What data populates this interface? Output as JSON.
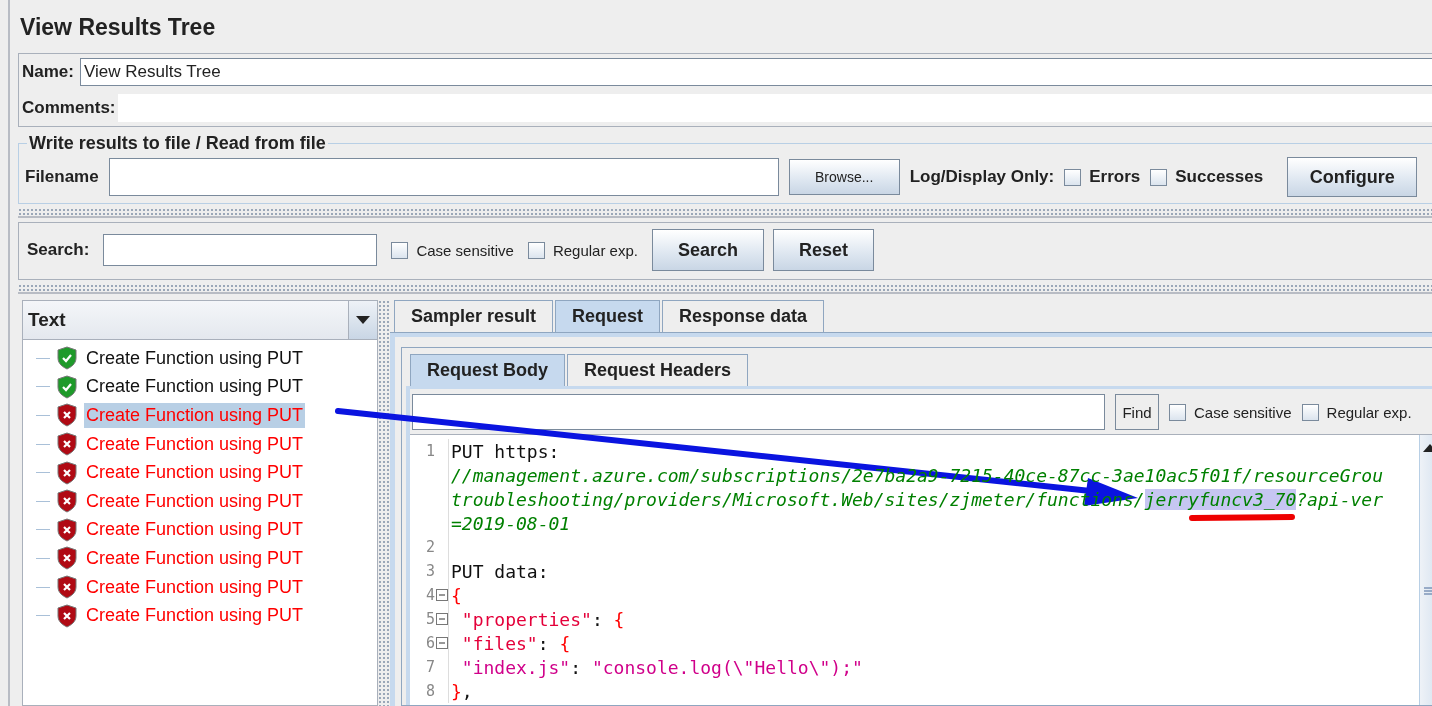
{
  "title": "View Results Tree",
  "name_field": {
    "label": "Name:",
    "value": "View Results Tree"
  },
  "comments_field": {
    "label": "Comments:"
  },
  "file_group": {
    "title": "Write results to file / Read from file",
    "filename_label": "Filename",
    "browse_button": "Browse...",
    "log_label": "Log/Display Only:",
    "options": [
      {
        "label": "Errors",
        "checked": false
      },
      {
        "label": "Successes",
        "checked": false
      }
    ],
    "configure_button": "Configure"
  },
  "search": {
    "label": "Search:",
    "options": [
      {
        "label": "Case sensitive",
        "checked": false
      },
      {
        "label": "Regular exp.",
        "checked": false
      }
    ],
    "buttons": [
      "Search",
      "Reset"
    ]
  },
  "tree": {
    "column": "Text",
    "items": [
      {
        "label": "Create Function using PUT",
        "kind": "success",
        "selected": false
      },
      {
        "label": "Create Function using PUT",
        "kind": "success",
        "selected": false
      },
      {
        "label": "Create Function using PUT",
        "kind": "failure",
        "selected": true
      },
      {
        "label": "Create Function using PUT",
        "kind": "failure",
        "selected": false
      },
      {
        "label": "Create Function using PUT",
        "kind": "failure",
        "selected": false
      },
      {
        "label": "Create Function using PUT",
        "kind": "failure",
        "selected": false
      },
      {
        "label": "Create Function using PUT",
        "kind": "failure",
        "selected": false
      },
      {
        "label": "Create Function using PUT",
        "kind": "failure",
        "selected": false
      },
      {
        "label": "Create Function using PUT",
        "kind": "failure",
        "selected": false
      },
      {
        "label": "Create Function using PUT",
        "kind": "failure",
        "selected": false
      }
    ]
  },
  "tabs": [
    {
      "label": "Sampler result",
      "selected": false
    },
    {
      "label": "Request",
      "selected": true
    },
    {
      "label": "Response data",
      "selected": false
    }
  ],
  "sub_tabs": [
    {
      "label": "Request Body",
      "selected": true
    },
    {
      "label": "Request Headers",
      "selected": false
    }
  ],
  "find_bar": {
    "button": "Find",
    "options": [
      {
        "label": "Case sensitive",
        "checked": false
      },
      {
        "label": "Regular exp.",
        "checked": false
      }
    ]
  },
  "code": {
    "lines": [
      {
        "number": "1",
        "foldable": false,
        "rows": [
          [
            {
              "text": "PUT https:",
              "kind": "plain",
              "highlighted": false
            }
          ],
          [
            {
              "text": "//management.azure.com/subscriptions/2e7ba2a9-7215-40ce-87cc-3ae10ac5f01f/resourceGrou",
              "kind": "url",
              "highlighted": false
            }
          ],
          [
            {
              "text": "troubleshooting/providers/Microsoft.Web/sites/zjmeter/functions/",
              "kind": "url",
              "highlighted": false
            },
            {
              "text": "jerryfuncv3_70",
              "kind": "url",
              "highlighted": true
            },
            {
              "text": "?api-ver",
              "kind": "url",
              "highlighted": false
            }
          ],
          [
            {
              "text": "=2019-08-01",
              "kind": "url",
              "highlighted": false
            }
          ]
        ]
      },
      {
        "number": "2",
        "foldable": false,
        "rows": [
          []
        ]
      },
      {
        "number": "3",
        "foldable": false,
        "rows": [
          [
            {
              "text": "PUT data:",
              "kind": "plain",
              "highlighted": false
            }
          ]
        ]
      },
      {
        "number": "4",
        "foldable": true,
        "rows": [
          [
            {
              "text": "{",
              "kind": "punct",
              "highlighted": false
            }
          ]
        ]
      },
      {
        "number": "5",
        "foldable": true,
        "rows": [
          [
            {
              "text": " \"properties\"",
              "kind": "key",
              "highlighted": false
            },
            {
              "text": ": ",
              "kind": "plain",
              "highlighted": false
            },
            {
              "text": "{",
              "kind": "punct",
              "highlighted": false
            }
          ]
        ]
      },
      {
        "number": "6",
        "foldable": true,
        "rows": [
          [
            {
              "text": " \"files\"",
              "kind": "key",
              "highlighted": false
            },
            {
              "text": ": ",
              "kind": "plain",
              "highlighted": false
            },
            {
              "text": "{",
              "kind": "punct",
              "highlighted": false
            }
          ]
        ]
      },
      {
        "number": "7",
        "foldable": false,
        "rows": [
          [
            {
              "text": " \"index.js\"",
              "kind": "string",
              "highlighted": false
            },
            {
              "text": ": ",
              "kind": "plain",
              "highlighted": false
            },
            {
              "text": "\"console.log(\\\"Hello\\\");\"",
              "kind": "string",
              "highlighted": false
            }
          ]
        ]
      },
      {
        "number": "8",
        "foldable": false,
        "rows": [
          [
            {
              "text": "}",
              "kind": "punct",
              "highlighted": false
            },
            {
              "text": ",",
              "kind": "plain",
              "highlighted": false
            }
          ]
        ]
      }
    ]
  }
}
